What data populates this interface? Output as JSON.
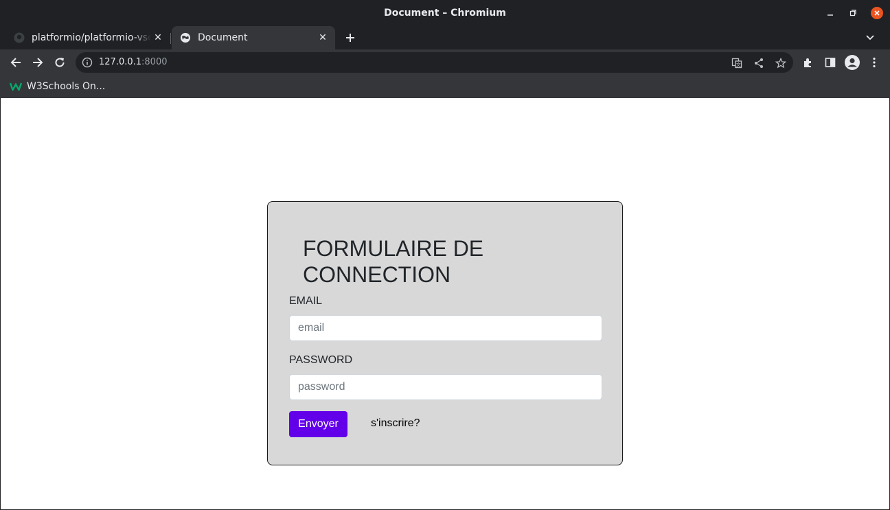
{
  "window": {
    "title": "Document – Chromium"
  },
  "tabs": [
    {
      "label": "platformio/platformio-vscode-ide",
      "active": false,
      "icon": "github-icon"
    },
    {
      "label": "Document",
      "active": true,
      "icon": "globe-icon"
    }
  ],
  "toolbar": {
    "url_host": "127.0.0.1",
    "url_port": ":8000"
  },
  "bookmarks": [
    {
      "label": "W3Schools On...",
      "icon": "w3schools-icon"
    }
  ],
  "form": {
    "title": "FORMULAIRE DE CONNECTION",
    "email_label": "EMAIL",
    "email_placeholder": "email",
    "password_label": "PASSWORD",
    "password_placeholder": "password",
    "submit_label": "Envoyer",
    "signup_link": "s'inscrire?"
  },
  "colors": {
    "accent": "#6200ea",
    "card_bg": "#d8d8d8",
    "close_button": "#e95420"
  }
}
